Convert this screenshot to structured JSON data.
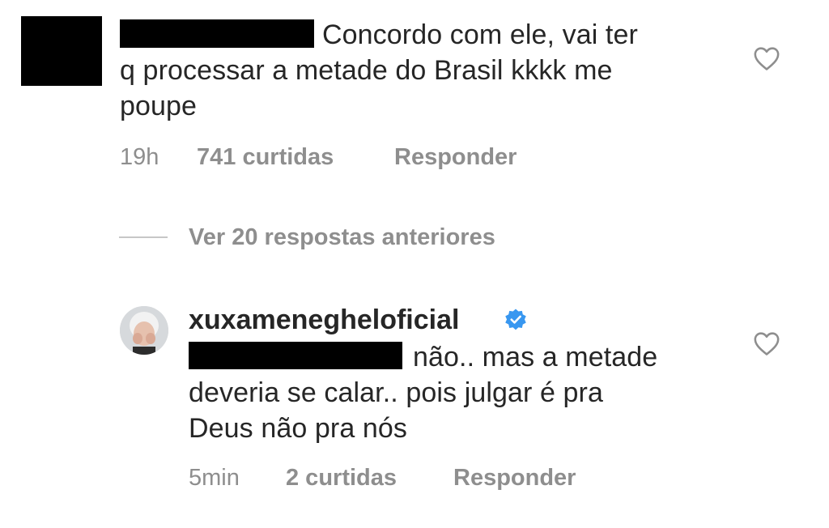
{
  "comments": [
    {
      "text_lines": [
        "Concordo com ele, vai ter",
        "q processar a metade do Brasil kkkk me",
        "poupe"
      ],
      "time": "19h",
      "likes": "741 curtidas",
      "reply_label": "Responder"
    },
    {
      "username": "xuxamenegheloficial",
      "verified": true,
      "text_lines": [
        "não.. mas a metade",
        "deveria se calar.. pois julgar é pra",
        "Deus não pra nós"
      ],
      "time": "5min",
      "likes": "2 curtidas",
      "reply_label": "Responder"
    }
  ],
  "view_replies": "Ver 20 respostas anteriores",
  "colors": {
    "text": "#262626",
    "secondary": "#8e8e8e",
    "verified_blue": "#3897f0",
    "redaction": "#000000"
  },
  "icons": {
    "like": "heart-outline-icon",
    "verified": "verified-badge-icon"
  }
}
